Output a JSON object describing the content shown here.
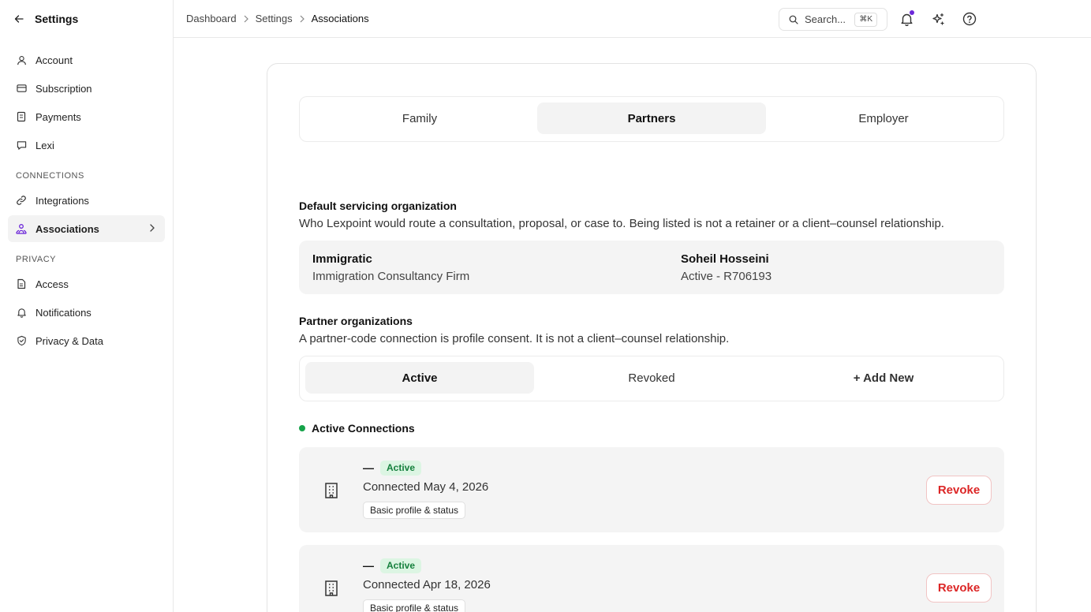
{
  "sidebar": {
    "title": "Settings",
    "groups": [
      {
        "label": "",
        "items": [
          {
            "label": "Account",
            "icon": "user-icon"
          },
          {
            "label": "Subscription",
            "icon": "credit-card-icon"
          },
          {
            "label": "Payments",
            "icon": "receipt-icon"
          },
          {
            "label": "Lexi",
            "icon": "chat-icon"
          }
        ]
      },
      {
        "label": "CONNECTIONS",
        "items": [
          {
            "label": "Integrations",
            "icon": "link-icon"
          },
          {
            "label": "Associations",
            "icon": "network-icon",
            "active": true
          }
        ]
      },
      {
        "label": "PRIVACY",
        "items": [
          {
            "label": "Access",
            "icon": "document-icon"
          },
          {
            "label": "Notifications",
            "icon": "bell-icon"
          },
          {
            "label": "Privacy & Data",
            "icon": "shield-icon"
          }
        ]
      }
    ]
  },
  "topbar": {
    "breadcrumb": [
      "Dashboard",
      "Settings",
      "Associations"
    ],
    "search_placeholder": "Search...",
    "search_shortcut": "⌘K",
    "notification_dot_color": "#6d28d9"
  },
  "tabs": {
    "items": [
      "Family",
      "Partners",
      "Employer"
    ],
    "selected": "Partners"
  },
  "default_org": {
    "heading": "Default servicing organization",
    "description": "Who Lexpoint would route a consultation, proposal, or case to. Being listed is not a retainer or a client–counsel relationship.",
    "org_name": "Immigratic",
    "org_type": "Immigration Consultancy Firm",
    "contact_name": "Soheil Hosseini",
    "contact_status": "Active - R706193"
  },
  "partners": {
    "heading": "Partner organizations",
    "description": "A partner-code connection is profile consent. It is not a client–counsel relationship.",
    "filter_tabs": [
      "Active",
      "Revoked",
      "+ Add New"
    ],
    "selected_filter": "Active",
    "section_title": "Active Connections",
    "connections": [
      {
        "name": "—",
        "status": "Active",
        "connected": "Connected May 4, 2026",
        "scope": "Basic profile & status",
        "action": "Revoke"
      },
      {
        "name": "—",
        "status": "Active",
        "connected": "Connected Apr 18, 2026",
        "scope": "Basic profile & status",
        "action": "Revoke"
      }
    ]
  },
  "colors": {
    "accent_purple": "#6d28d9",
    "active_green": "#16a34a",
    "revoke_red": "#dc2626"
  }
}
